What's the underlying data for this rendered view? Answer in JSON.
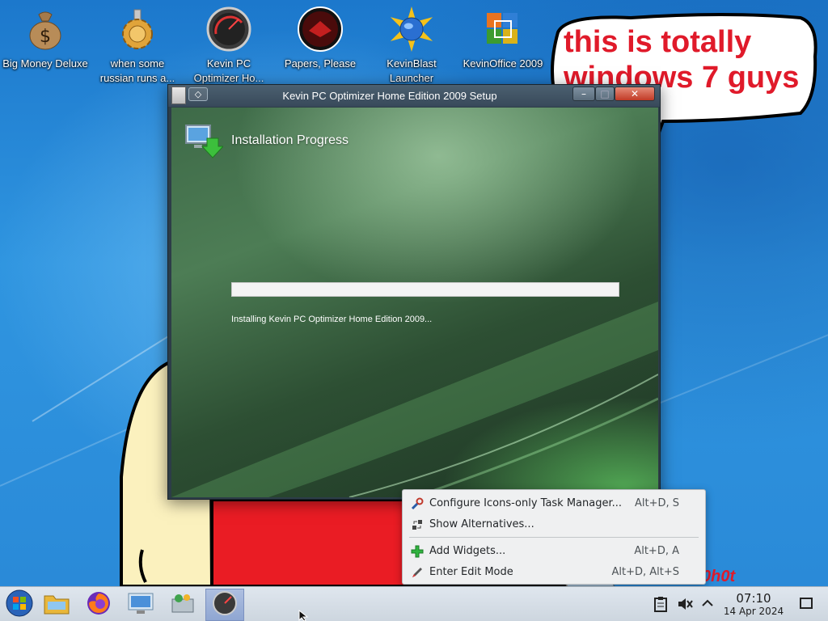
{
  "desktop": {
    "icons": [
      {
        "label": "Big Money Deluxe",
        "icon": "money-bag-icon"
      },
      {
        "label": "when some russian runs a...",
        "icon": "gear-icon"
      },
      {
        "label": "Kevin PC Optimizer Ho...",
        "icon": "speedometer-icon"
      },
      {
        "label": "Papers, Please",
        "icon": "papers-please-icon"
      },
      {
        "label": "KevinBlast Launcher",
        "icon": "globe-burst-icon"
      },
      {
        "label": "KevinOffice 2009",
        "icon": "office-icon"
      }
    ],
    "bubble_text": "this is totally windows 7 guys",
    "partial_graffiti": "0h0t"
  },
  "window": {
    "title": "Kevin PC Optimizer Home Edition 2009 Setup",
    "heading": "Installation Progress",
    "progress_percent": 0,
    "status": "Installing Kevin PC Optimizer Home Edition 2009..."
  },
  "context_menu": {
    "items": [
      {
        "label": "Configure Icons-only Task Manager...",
        "shortcut": "Alt+D, S",
        "icon": "wrench-icon"
      },
      {
        "label": "Show Alternatives...",
        "shortcut": "",
        "icon": "alternatives-icon"
      },
      {
        "label": "Add Widgets...",
        "shortcut": "Alt+D, A",
        "icon": "plus-icon"
      },
      {
        "label": "Enter Edit Mode",
        "shortcut": "Alt+D, Alt+S",
        "icon": "pencil-icon"
      }
    ]
  },
  "taskbar": {
    "apps": [
      "start-orb-icon",
      "file-manager-icon",
      "firefox-icon",
      "system-settings-icon",
      "store-icon",
      "speedometer-icon"
    ],
    "clock_time": "07:10",
    "clock_date": "14 Apr 2024",
    "colors": {
      "accent": "#2f95e0",
      "progress": "#35b43f",
      "bubble_text": "#e01a2a"
    }
  }
}
